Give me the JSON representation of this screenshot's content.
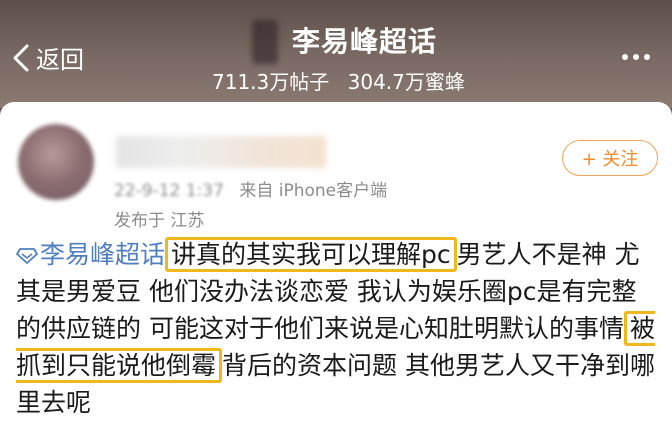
{
  "header": {
    "back_label": "返回",
    "title": "李易峰超话",
    "stats": {
      "posts": "711.3万帖子",
      "fans": "304.7万蜜蜂"
    }
  },
  "post": {
    "meta": {
      "timestamp": "22-9-12 1:37",
      "source": "来自 iPhone客户端",
      "location": "发布于 江苏"
    },
    "follow_label": "+ 关注",
    "topic": "李易峰超话",
    "highlight_1": "讲真的其实我可以理解pc",
    "text_1": "男艺人不是神 尤其是男爱豆 他们没办法谈恋爱 我认为娱乐圈pc是有完整的供应链的 可能这对于他们来说是心知肚明默认的事情",
    "highlight_2": "被抓到只能说他倒霉",
    "text_2": "背后的资本问题 其他男艺人又干净到哪里去呢"
  },
  "colors": {
    "header_bg": "#6a5b55",
    "topic_link": "#4f7fbf",
    "follow_accent": "#f08c2c",
    "highlight_border": "#f0b81c"
  }
}
